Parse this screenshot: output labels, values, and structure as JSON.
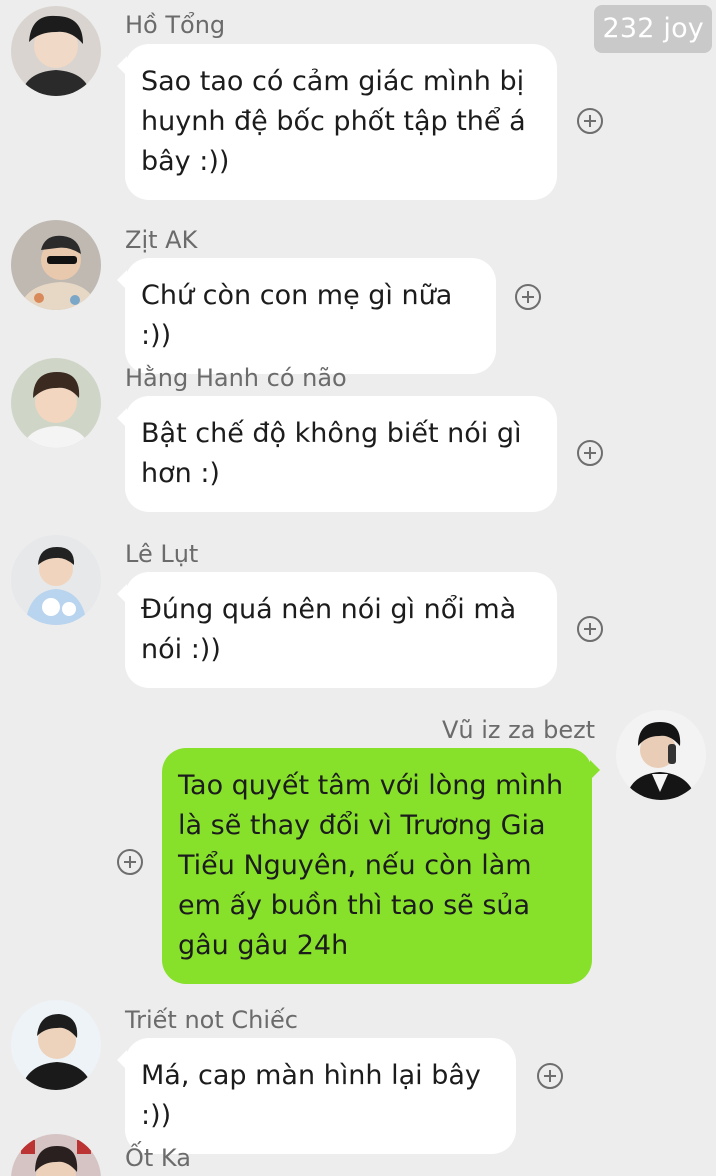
{
  "header": {
    "badge": "232 joy"
  },
  "messages": [
    {
      "sender": "Hồ Tổng",
      "text": "Sao tao có cảm giác mình bị huynh đệ bốc phốt tập thể á bây :))",
      "side": "left"
    },
    {
      "sender": "Zịt AK",
      "text": "Chứ còn con mẹ gì nữa :))",
      "side": "left"
    },
    {
      "sender": "Hằng Hanh có não",
      "text": "Bật chế độ không biết nói gì hơn :)",
      "side": "left"
    },
    {
      "sender": "Lê Lụt",
      "text": "Đúng quá nên nói gì nổi mà nói :))",
      "side": "left"
    },
    {
      "sender": "Vũ iz za bezt",
      "text": "Tao quyết tâm với lòng mình là sẽ thay đổi vì Trương Gia Tiểu Nguyên, nếu còn làm em ấy buồn thì tao sẽ sủa gâu gâu 24h",
      "side": "right"
    },
    {
      "sender": "Triết not Chiếc",
      "text": "Má, cap màn hình lại bây :))",
      "side": "left"
    },
    {
      "sender": "Ốt Ka",
      "text": "",
      "side": "left"
    }
  ],
  "colors": {
    "background": "#ededed",
    "bubble_incoming": "#ffffff",
    "bubble_outgoing": "#87e12b",
    "badge_bg": "#c9c9c9"
  },
  "icons": {
    "add_reaction": "plus-circle-icon",
    "avatar": "avatar"
  }
}
